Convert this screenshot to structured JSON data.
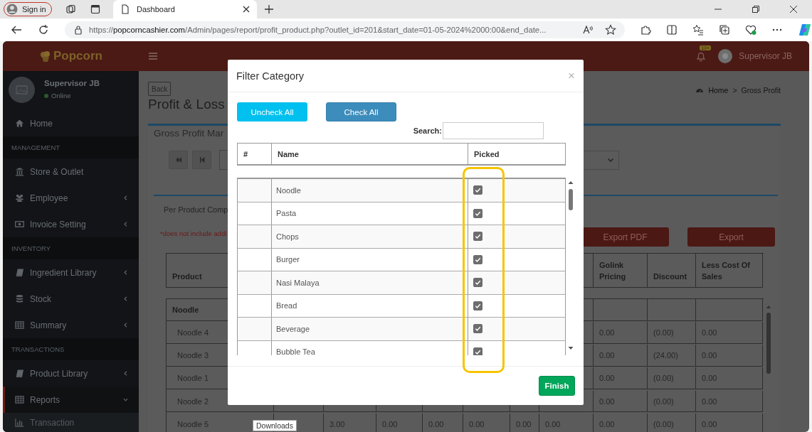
{
  "browser": {
    "sign_in": "Sign in",
    "tab_title": "Dashboard",
    "url": {
      "scheme": "https://",
      "host": "popcorncashier.com",
      "path": "/Admin/pages/report/profit_product.php?outlet_id=201&start_date=01-05-2024%2000:00&end_date..."
    }
  },
  "header": {
    "logo": "Popcorn",
    "badge": "10+",
    "user": "Supervisor JB"
  },
  "sidebar": {
    "user_name": "Supervisor JB",
    "status": "Online",
    "items": [
      {
        "kind": "link",
        "label": "Home",
        "selected": false
      },
      {
        "kind": "header",
        "label": "MANAGEMENT"
      },
      {
        "kind": "link",
        "label": "Store & Outlet",
        "selected": false
      },
      {
        "kind": "link",
        "label": "Employee",
        "selected": false,
        "expanded": false
      },
      {
        "kind": "link",
        "label": "Invoice Setting",
        "selected": false,
        "expanded": false
      },
      {
        "kind": "header",
        "label": "INVENTORY"
      },
      {
        "kind": "link",
        "label": "Ingredient Library",
        "selected": false,
        "expanded": false
      },
      {
        "kind": "link",
        "label": "Stock",
        "selected": false,
        "expanded": false
      },
      {
        "kind": "link",
        "label": "Summary",
        "selected": false,
        "expanded": false
      },
      {
        "kind": "header",
        "label": "TRANSACTIONS"
      },
      {
        "kind": "link",
        "label": "Product Library",
        "selected": false,
        "expanded": false
      },
      {
        "kind": "link",
        "label": "Reports",
        "selected": true,
        "expanded": true
      },
      {
        "kind": "subitem",
        "label": "Transaction",
        "selected": false
      }
    ]
  },
  "content": {
    "back": "Back",
    "title": "Profit & Loss",
    "breadcrumb": [
      "Home",
      "Gross Profit"
    ],
    "breadcrumb_separator": ">",
    "panel_title": "Gross Profit Mar",
    "subtab": "Per Product Comp",
    "note": "*does not include addi",
    "exports": [
      "Export PDF",
      "Export"
    ],
    "table": {
      "columns": [
        "Product",
        "Golink Pricing",
        "Discount",
        "Less Cost Of Sales"
      ],
      "group": "Noodle",
      "rows": [
        {
          "product": "Noodle 4",
          "values": [
            "0.00",
            "(0.00)",
            "0.00"
          ]
        },
        {
          "product": "Noodle 3",
          "values": [
            "0.00",
            "(24.00)",
            "0.00"
          ]
        },
        {
          "product": "Noodle 1",
          "values": [
            "0.00",
            "(0.00)",
            "0.00"
          ]
        },
        {
          "product": "Noodle 2",
          "values": [
            "0.00",
            "(0.00)",
            "0.00"
          ]
        },
        {
          "product": "Noodle 5",
          "middle": [
            "3.00",
            "0.00",
            "0.00",
            "0.00",
            "0.00",
            "0.00"
          ],
          "values": [
            "0.00",
            "(0.00)",
            "0.00"
          ]
        }
      ]
    }
  },
  "modal": {
    "title": "Filter Category",
    "close": "×",
    "buttons": [
      "Uncheck All",
      "Check All"
    ],
    "search_label": "Search:",
    "columns": [
      "#",
      "Name",
      "Picked"
    ],
    "rows": [
      {
        "name": "Noodle",
        "picked": true
      },
      {
        "name": "Pasta",
        "picked": true
      },
      {
        "name": "Chops",
        "picked": true
      },
      {
        "name": "Burger",
        "picked": true
      },
      {
        "name": "Nasi Malaya",
        "picked": true
      },
      {
        "name": "Bread",
        "picked": true
      },
      {
        "name": "Beverage",
        "picked": true
      },
      {
        "name": "Bubble Tea",
        "picked": true
      }
    ],
    "finish": "Finish"
  },
  "tooltip": "Downloads"
}
